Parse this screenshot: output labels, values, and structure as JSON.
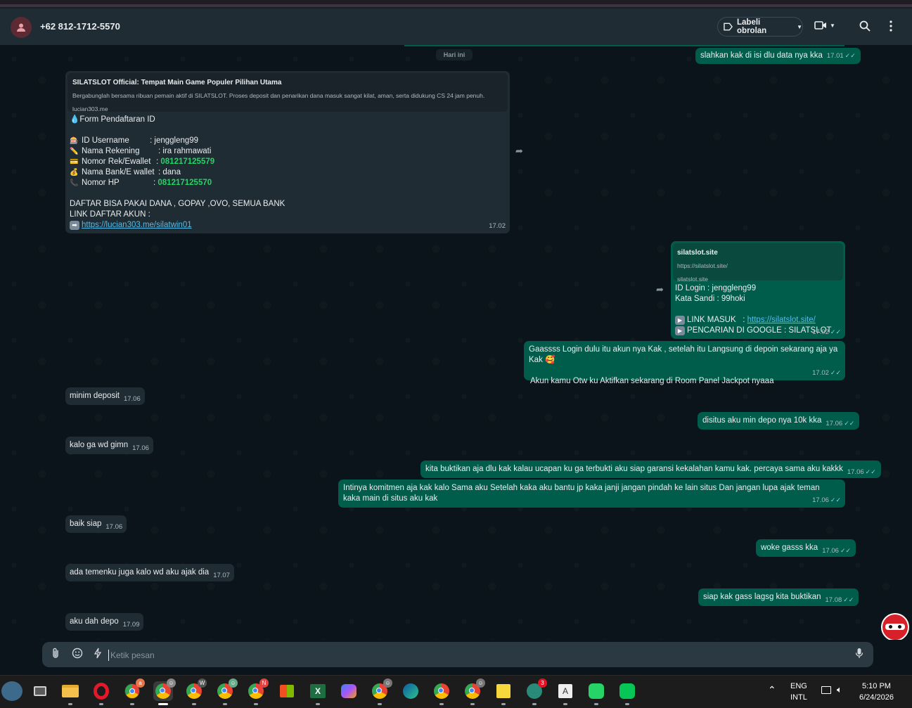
{
  "header": {
    "contact_name": "+62 812-1712-5570",
    "label_button": "Labeli obrolan"
  },
  "chat": {
    "date_chip": "Hari ini",
    "messages": [
      {
        "dir": "out",
        "text": "slahkan kak di isi dlu data nya kka",
        "time": "17.01"
      },
      {
        "dir": "in",
        "preview_title": "SILATSLOT Official: Tempat Main Game Populer Pilihan Utama",
        "preview_desc": "Bergabunglah bersama ribuan pemain aktif di SILATSLOT. Proses deposit dan penarikan dana masuk sangat kilat, aman, serta didukung CS 24 jam penuh.",
        "preview_domain": "lucian303.me",
        "form_title": "Form Pendaftaran ID",
        "fields": [
          {
            "label": "ID Username",
            "value": ": jenggleng99"
          },
          {
            "label": "Nama Rekening",
            "value": ": ira rahmawati"
          },
          {
            "label": "Nomor Rek/Ewallet",
            "value": "081217125579",
            "sep": ": "
          },
          {
            "label": "Nama Bank/E wallet",
            "value": ": dana"
          },
          {
            "label": "Nomor HP",
            "value": "081217125570",
            "sep": ": "
          }
        ],
        "line1": "DAFTAR BISA PAKAI DANA , GOPAY ,OVO, SEMUA BANK",
        "line2": "LINK DAFTAR AKUN :",
        "link": "https://lucian303.me/silatwin01",
        "time": "17.02"
      },
      {
        "dir": "out",
        "preview_title": "silatslot.site",
        "preview_url": "https://silatslot.site/",
        "preview_domain": "silatslot.site",
        "login": "ID Login : jenggleng99",
        "password": "Kata Sandi : 99hoki",
        "link_label": "LINK MASUK   : ",
        "link": "https://silatslot.site/",
        "search_label": "PENCARIAN DI GOOGLE : SILATSLOT",
        "time": "17.02"
      },
      {
        "dir": "out",
        "text": "Gaassss Login dulu itu akun nya Kak  , setelah itu Langsung di depoin sekarang aja ya Kak 🥰",
        "text2": "Akun kamu Otw ku Aktifkan sekarang di Room Panel Jackpot nyaaa",
        "time": "17.02"
      },
      {
        "dir": "in",
        "text": "minim deposit",
        "time": "17.06"
      },
      {
        "dir": "out",
        "text": "disitus aku min depo nya 10k kka",
        "time": "17.06"
      },
      {
        "dir": "in",
        "text": "kalo ga wd gimn",
        "time": "17.06"
      },
      {
        "dir": "out",
        "text": "kita buktikan aja dlu kak kalau ucapan ku ga terbukti aku siap garansi kekalahan kamu kak. percaya sama aku kakkk",
        "time": "17.06"
      },
      {
        "dir": "out",
        "text": "Intinya komitmen aja kak kalo Sama aku Setelah kaka aku bantu jp kaka janji jangan pindah ke lain situs Dan jangan lupa ajak teman kaka main di situs aku kak",
        "time": "17.06"
      },
      {
        "dir": "in",
        "text": "baik siap",
        "time": "17.06"
      },
      {
        "dir": "out",
        "text": "woke gasss kka",
        "time": "17.06"
      },
      {
        "dir": "in",
        "text": "ada temenku juga kalo wd aku ajak dia",
        "time": "17.07"
      },
      {
        "dir": "out",
        "text": "siap kak gass lagsg kita buktikan",
        "time": "17.08"
      },
      {
        "dir": "in",
        "text": "aku dah depo",
        "time": "17.09"
      }
    ]
  },
  "composer": {
    "placeholder": "Ketik pesan"
  },
  "taskbar": {
    "lang_top": "ENG",
    "lang_bottom": "INTL",
    "time": "5:10 PM",
    "date": "6/24/2026",
    "badge_count": "3",
    "profile_letters": [
      "a",
      "W",
      "N"
    ]
  },
  "colors": {
    "incoming": "#202c33",
    "outgoing": "#005c4b",
    "header": "#202c33",
    "background": "#0b141a"
  }
}
